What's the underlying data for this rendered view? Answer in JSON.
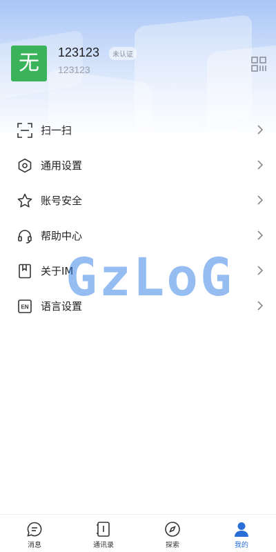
{
  "profile": {
    "avatar_text": "无",
    "name": "123123",
    "badge": "未认证",
    "user_id": "123123",
    "avatar_color": "#3bb35a"
  },
  "menu": [
    {
      "label": "扫一扫",
      "icon": "scan-icon"
    },
    {
      "label": "通用设置",
      "icon": "settings-icon"
    },
    {
      "label": "账号安全",
      "icon": "star-icon"
    },
    {
      "label": "帮助中心",
      "icon": "headset-icon"
    },
    {
      "label": "关于IM",
      "icon": "book-icon"
    },
    {
      "label": "语言设置",
      "icon": "language-en-icon"
    }
  ],
  "watermark": "GzLoG",
  "tabs": [
    {
      "label": "消息",
      "icon": "chat-icon"
    },
    {
      "label": "通讯录",
      "icon": "contacts-icon"
    },
    {
      "label": "探索",
      "icon": "compass-icon"
    },
    {
      "label": "我的",
      "icon": "user-icon",
      "active": true
    }
  ],
  "colors": {
    "accent": "#2a6fd6",
    "watermark": "#2f7de6"
  }
}
